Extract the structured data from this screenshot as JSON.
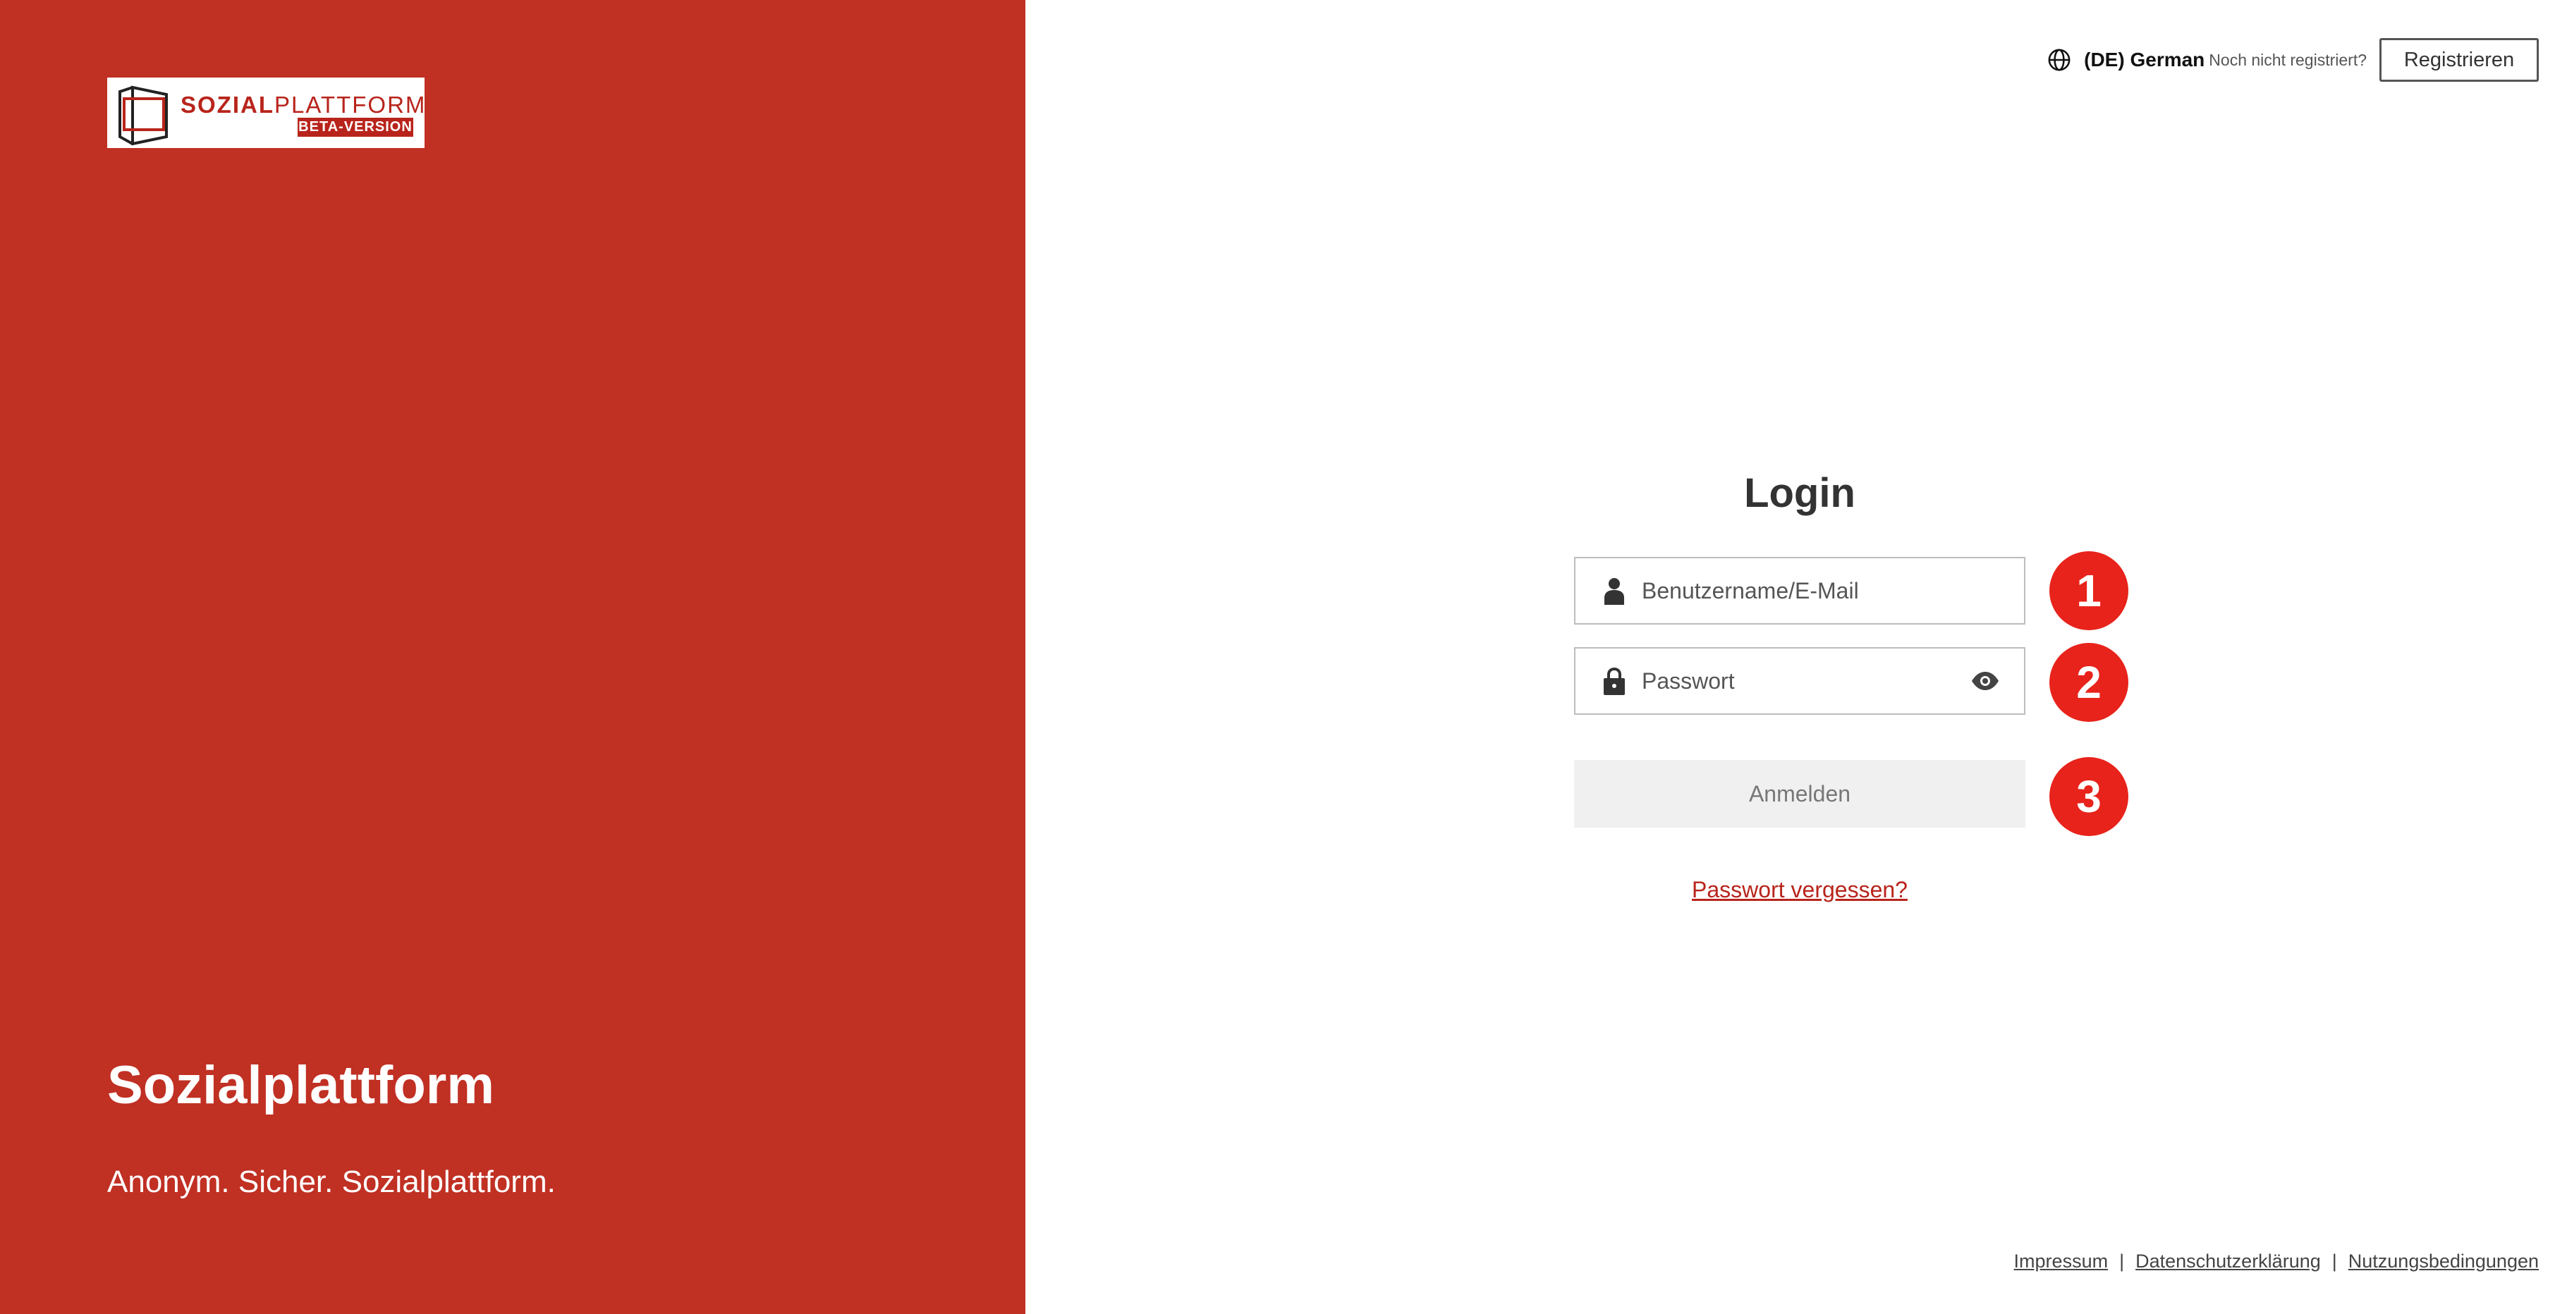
{
  "brand": {
    "logo_word_bold": "SOZIAL",
    "logo_word_light": "PLATTFORM",
    "logo_badge": "BETA-VERSION",
    "title": "Sozialplattform",
    "tagline": "Anonym. Sicher. Sozialplattform."
  },
  "header": {
    "language_label": "(DE) German",
    "not_registered_text": "Noch nicht registriert?",
    "register_button": "Registrieren"
  },
  "login": {
    "title": "Login",
    "username_placeholder": "Benutzername/E-Mail",
    "password_placeholder": "Passwort",
    "submit_label": "Anmelden",
    "forgot_password_link": "Passwort vergessen?"
  },
  "step_markers": [
    "1",
    "2",
    "3"
  ],
  "footer": {
    "links": [
      "Impressum",
      "Datenschutzerklärung",
      "Nutzungsbedingungen"
    ],
    "separator": "|"
  },
  "colors": {
    "brand_red": "#c03023",
    "marker_red": "#e8231b",
    "link_red": "#b8241b"
  }
}
